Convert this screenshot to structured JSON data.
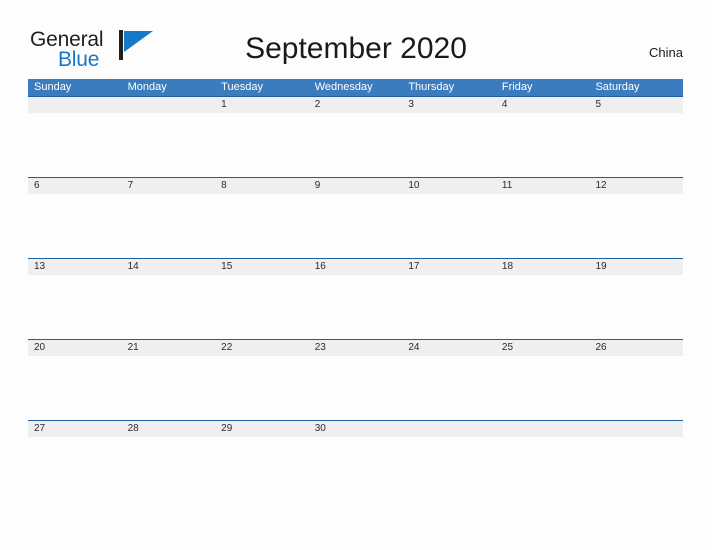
{
  "brand": {
    "name_part1": "General",
    "name_part2": "Blue",
    "flag_icon": "flag-icon",
    "flag_color": "#1878c8",
    "pole_color": "#231f20"
  },
  "header": {
    "title": "September 2020",
    "region": "China"
  },
  "theme": {
    "header_blue": "#3a7cbe",
    "row_border_blue": "#1f5fa0",
    "row_band_gray": "#efefef",
    "page_background": "#fdfdfd",
    "text_color": "#2b2b2b",
    "link_blue": "#1878c8"
  },
  "calendar": {
    "weekday_headers": [
      "Sunday",
      "Monday",
      "Tuesday",
      "Wednesday",
      "Thursday",
      "Friday",
      "Saturday"
    ],
    "weeks": [
      [
        "",
        "",
        "1",
        "2",
        "3",
        "4",
        "5"
      ],
      [
        "6",
        "7",
        "8",
        "9",
        "10",
        "11",
        "12"
      ],
      [
        "13",
        "14",
        "15",
        "16",
        "17",
        "18",
        "19"
      ],
      [
        "20",
        "21",
        "22",
        "23",
        "24",
        "25",
        "26"
      ],
      [
        "27",
        "28",
        "29",
        "30",
        "",
        "",
        ""
      ]
    ]
  }
}
